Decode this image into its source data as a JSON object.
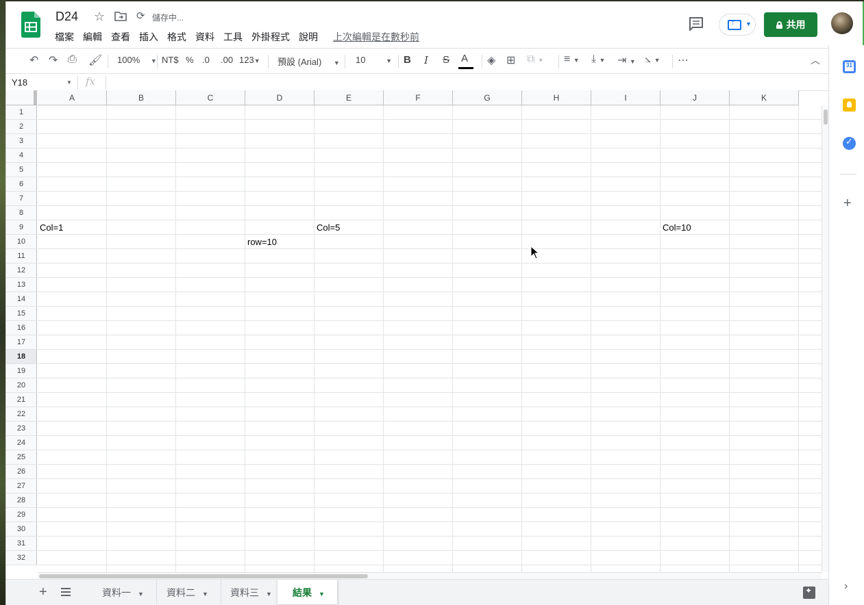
{
  "app": {
    "doc_title": "D24",
    "saving_status": "儲存中...",
    "last_edit": "上次編輯是在數秒前",
    "share_label": "共用",
    "menu": [
      "檔案",
      "編輯",
      "查看",
      "插入",
      "格式",
      "資料",
      "工具",
      "外掛程式",
      "說明"
    ]
  },
  "toolbar": {
    "zoom": "100%",
    "currency": "NT$",
    "percent": "%",
    "decimal_decrease": ".0",
    "decimal_increase": ".00",
    "more_formats": "123",
    "font": "預設 (Arial)",
    "font_size": "10",
    "bold": "B",
    "italic": "I",
    "strike": "S",
    "text_color": "A"
  },
  "formula_bar": {
    "name_box": "Y18",
    "fx": "fx",
    "content": ""
  },
  "grid": {
    "columns": [
      "A",
      "B",
      "C",
      "D",
      "E",
      "F",
      "G",
      "H",
      "I",
      "J",
      "K"
    ],
    "rows": [
      "1",
      "2",
      "3",
      "4",
      "5",
      "6",
      "7",
      "8",
      "9",
      "10",
      "11",
      "12",
      "13",
      "14",
      "15",
      "16",
      "17",
      "18",
      "19",
      "20",
      "21",
      "22",
      "23",
      "24",
      "25",
      "26",
      "27",
      "28",
      "29",
      "30",
      "31",
      "32"
    ],
    "active_row": "18",
    "cells": [
      {
        "ref": "A9",
        "value": "Col=1"
      },
      {
        "ref": "E9",
        "value": "Col=5"
      },
      {
        "ref": "J9",
        "value": "Col=10"
      },
      {
        "ref": "D10",
        "value": "row=10"
      }
    ]
  },
  "sheets": [
    {
      "name": "資料一",
      "active": false
    },
    {
      "name": "資料二",
      "active": false
    },
    {
      "name": "資料三",
      "active": false
    },
    {
      "name": "結果",
      "active": true
    }
  ],
  "colors": {
    "brand_green": "#188038",
    "accent_blue": "#1a73e8"
  }
}
